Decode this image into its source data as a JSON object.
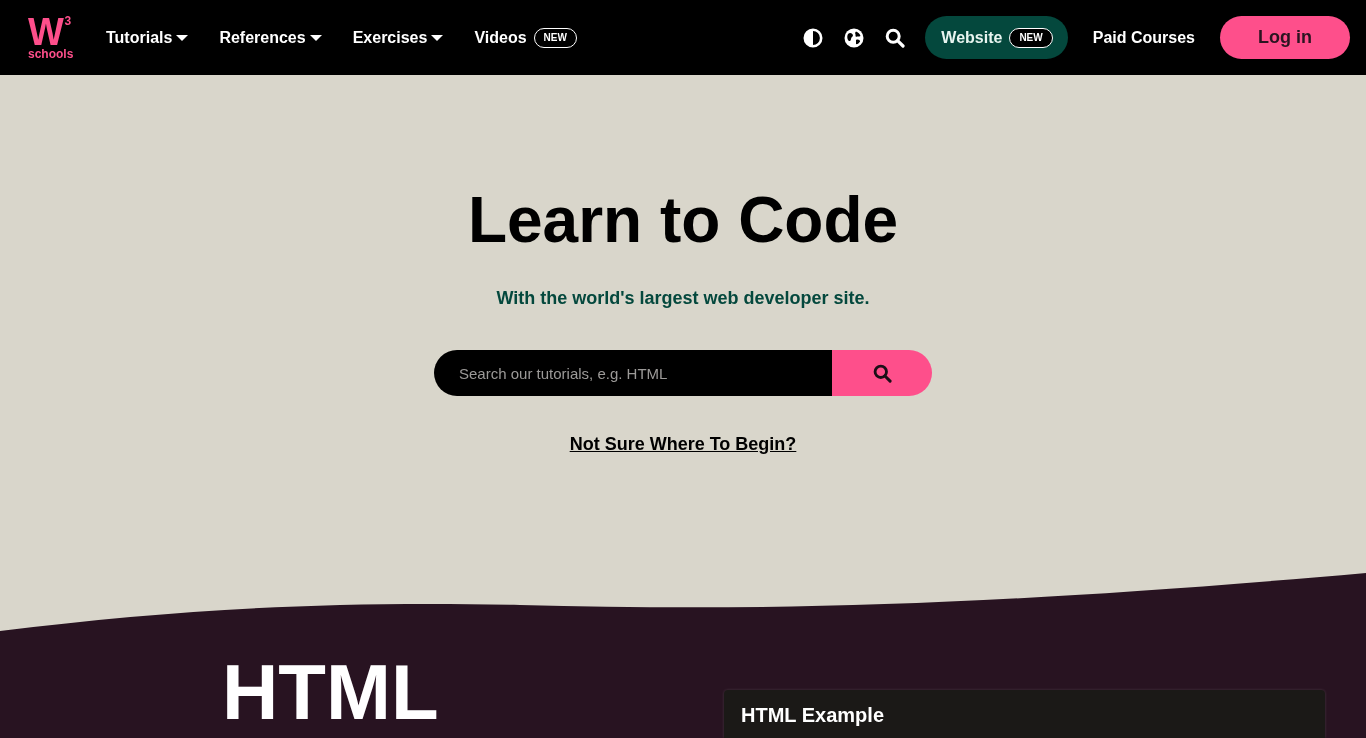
{
  "nav": {
    "logo": {
      "mark": "W",
      "superscript": "3",
      "wordmark": "schools"
    },
    "menus": [
      {
        "kind": "dropdown",
        "label": "Tutorials"
      },
      {
        "kind": "dropdown",
        "label": "References"
      },
      {
        "kind": "dropdown",
        "label": "Exercises"
      },
      {
        "kind": "badge",
        "label": "Videos",
        "badge": "NEW"
      }
    ],
    "website_button": {
      "label": "Website",
      "badge": "NEW"
    },
    "paid_courses_link": "Paid Courses",
    "login_button": "Log in"
  },
  "hero": {
    "title": "Learn to Code",
    "subtitle": "With the world's largest web developer site.",
    "search": {
      "placeholder": "Search our tutorials, e.g. HTML"
    },
    "link": "Not Sure Where To Begin?"
  },
  "next_section": {
    "heading": "HTML",
    "example_card": {
      "title": "HTML Example"
    }
  }
}
